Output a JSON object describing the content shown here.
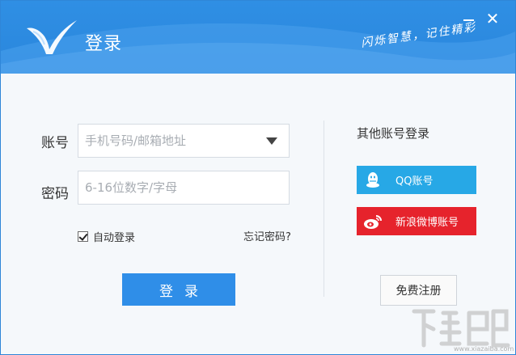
{
  "header": {
    "title": "登录",
    "slogan": "闪烁智慧，记住精彩",
    "minimize_icon": "minimize-icon",
    "close_icon": "close-icon",
    "close_glyph": "✕"
  },
  "login_form": {
    "account_label": "账号",
    "account_placeholder": "手机号码/邮箱地址",
    "password_label": "密码",
    "password_placeholder": "6-16位数字/字母",
    "auto_login_label": "自动登录",
    "auto_login_checked": true,
    "forgot_password_label": "忘记密码?",
    "login_button_label": "登录"
  },
  "social_login": {
    "title": "其他账号登录",
    "qq_label": "QQ账号",
    "weibo_label": "新浪微博账号"
  },
  "register_button_label": "免费注册",
  "watermark": {
    "text": "下载吧",
    "url": "www.xiazaiba.com"
  },
  "colors": {
    "header_blue": "#2f8fe4",
    "login_button": "#2f8ee8",
    "qq_blue": "#27a8e6",
    "weibo_red": "#e6232c"
  }
}
